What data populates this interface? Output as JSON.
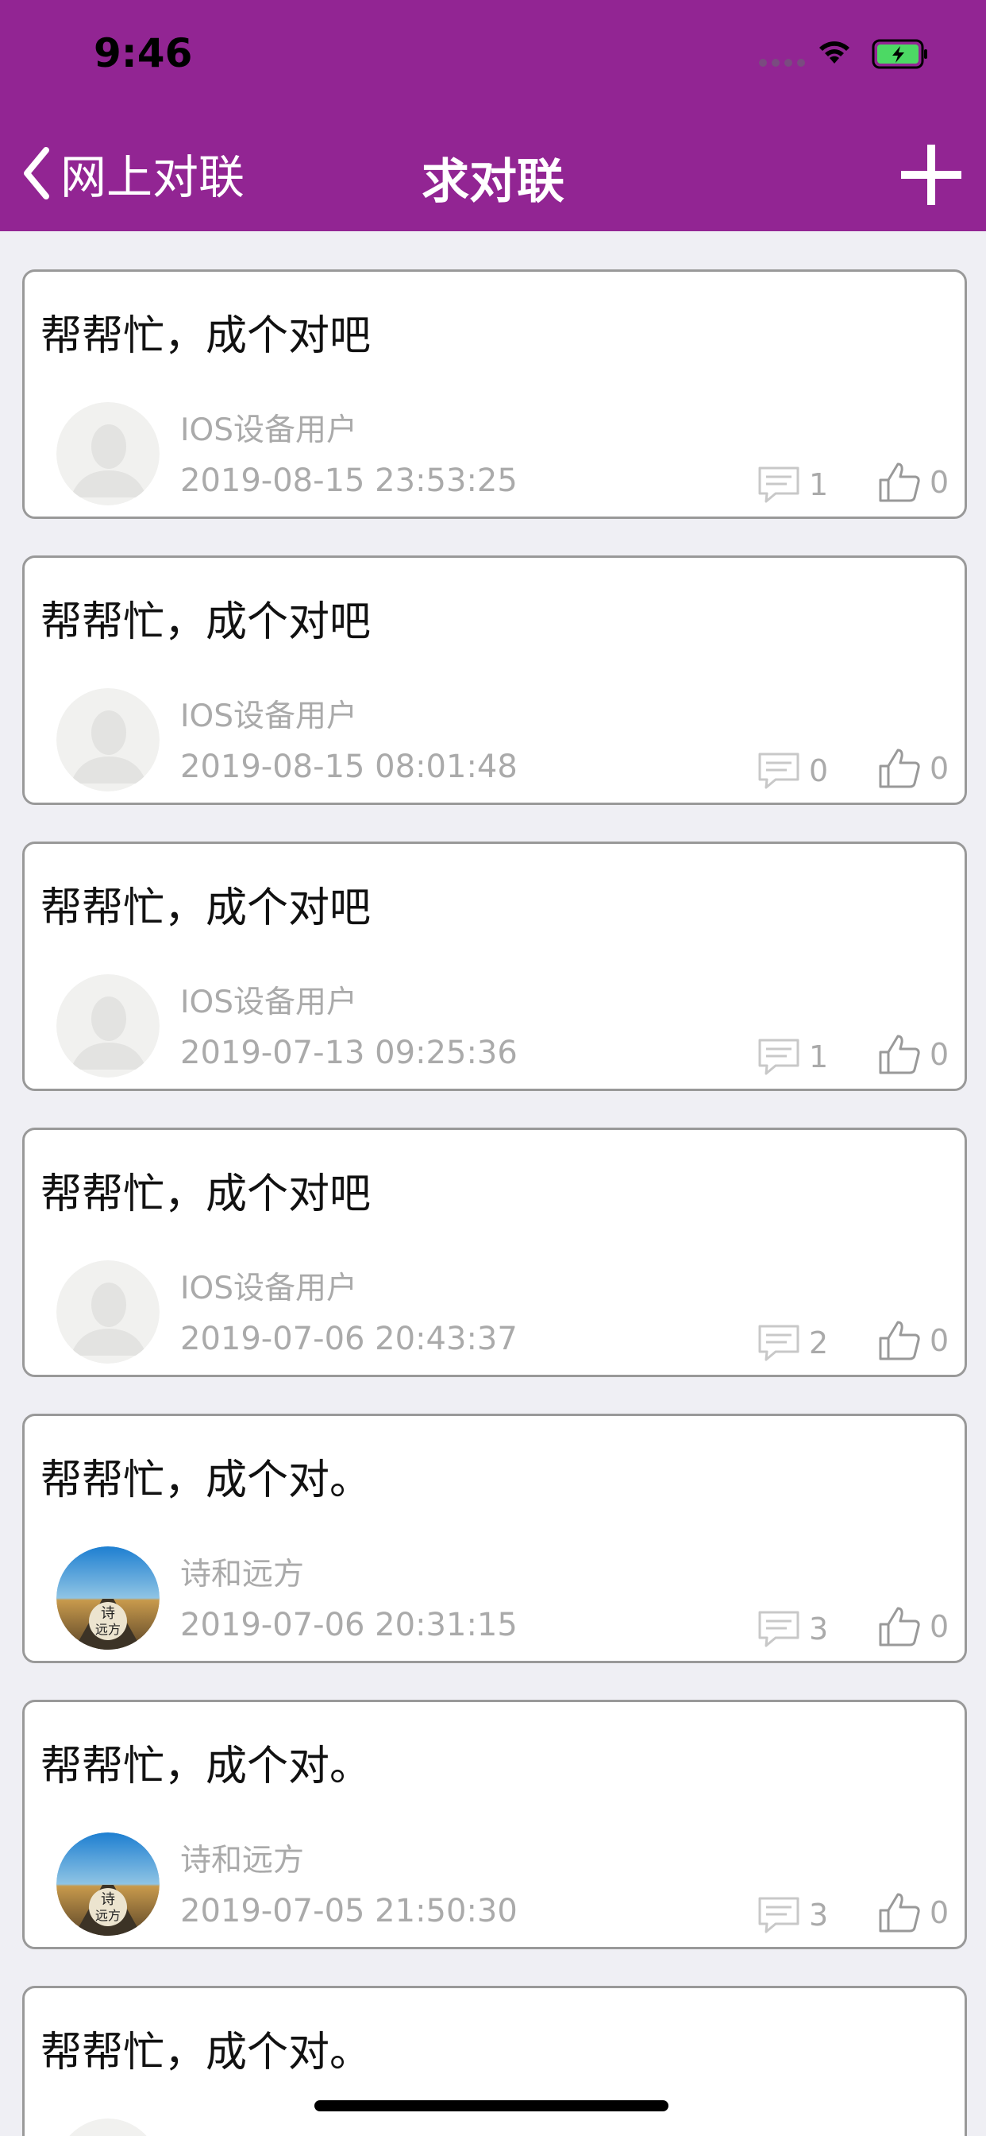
{
  "status_bar": {
    "time": "9:46"
  },
  "nav": {
    "back_label": "网上对联",
    "title": "求对联",
    "add_icon": "plus-icon"
  },
  "colors": {
    "brand": "#922593",
    "background": "#efeff4",
    "muted": "#aaaaaa"
  },
  "posts": [
    {
      "title": "帮帮忙，成个对吧",
      "user": "IOS设备用户",
      "time": "2019-08-15 23:53:25",
      "comments": "1",
      "likes": "0",
      "avatar": "default-avatar"
    },
    {
      "title": "帮帮忙，成个对吧",
      "user": "IOS设备用户",
      "time": "2019-08-15 08:01:48",
      "comments": "0",
      "likes": "0",
      "avatar": "default-avatar"
    },
    {
      "title": "帮帮忙，成个对吧",
      "user": "IOS设备用户",
      "time": "2019-07-13 09:25:36",
      "comments": "1",
      "likes": "0",
      "avatar": "default-avatar"
    },
    {
      "title": "帮帮忙，成个对吧",
      "user": "IOS设备用户",
      "time": "2019-07-06 20:43:37",
      "comments": "2",
      "likes": "0",
      "avatar": "default-avatar"
    },
    {
      "title": "帮帮忙，成个对。",
      "user": "诗和远方",
      "time": "2019-07-06 20:31:15",
      "comments": "3",
      "likes": "0",
      "avatar": "road-avatar"
    },
    {
      "title": "帮帮忙，成个对。",
      "user": "诗和远方",
      "time": "2019-07-05 21:50:30",
      "comments": "3",
      "likes": "0",
      "avatar": "road-avatar"
    },
    {
      "title": "帮帮忙，成个对。",
      "user": "",
      "time": "",
      "comments": "",
      "likes": "",
      "avatar": "default-avatar"
    }
  ]
}
